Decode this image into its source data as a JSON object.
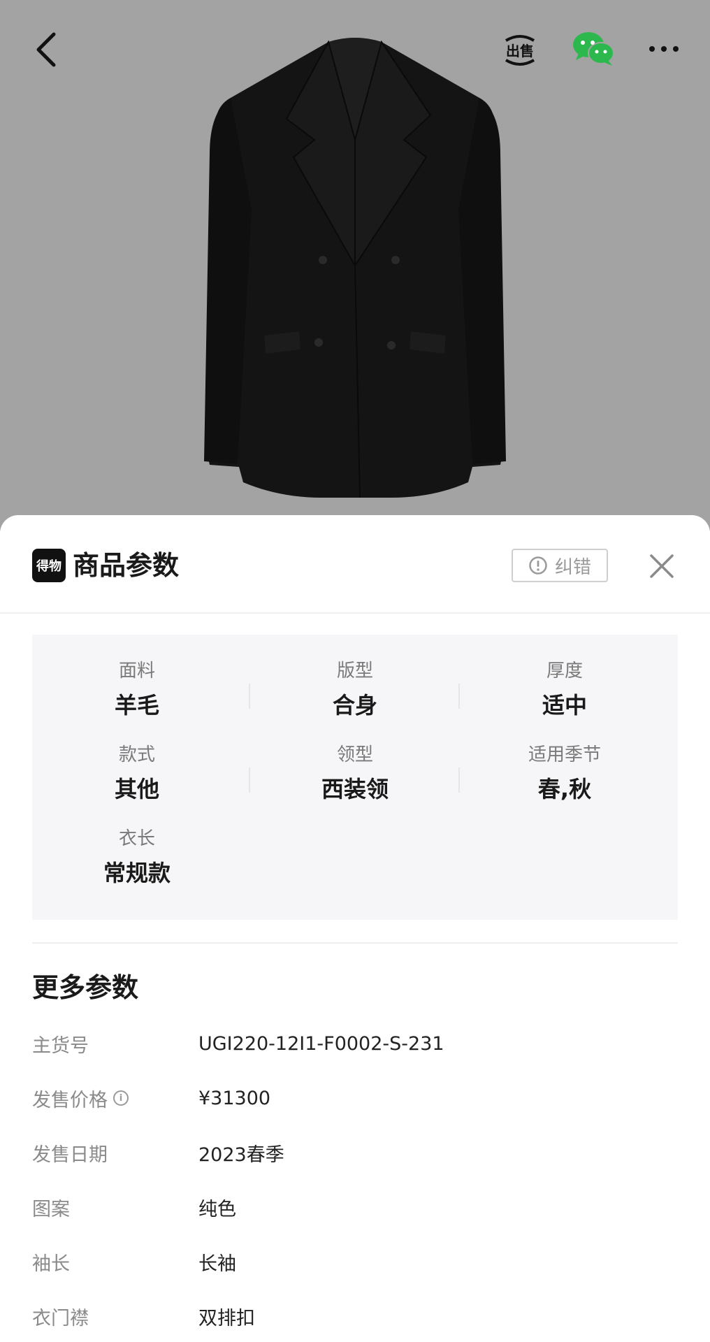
{
  "header": {
    "back_icon": "chevron-left-icon",
    "sell_label": "出售",
    "wechat_icon": "wechat-icon",
    "more_icon": "more-dots-icon"
  },
  "sheet": {
    "logo_text": "得物",
    "title": "商品参数",
    "correct_label": "纠错",
    "close_icon": "close-icon"
  },
  "key_params": [
    {
      "label": "面料",
      "value": "羊毛"
    },
    {
      "label": "版型",
      "value": "合身"
    },
    {
      "label": "厚度",
      "value": "适中"
    },
    {
      "label": "款式",
      "value": "其他"
    },
    {
      "label": "领型",
      "value": "西装领"
    },
    {
      "label": "适用季节",
      "value": "春,秋"
    },
    {
      "label": "衣长",
      "value": "常规款"
    }
  ],
  "more": {
    "title": "更多参数",
    "rows": [
      {
        "label": "主货号",
        "value": "UGI220-12I1-F0002-S-231"
      },
      {
        "label": "发售价格",
        "value": "¥31300"
      },
      {
        "label": "发售日期",
        "value": "2023春季"
      },
      {
        "label": "图案",
        "value": "纯色"
      },
      {
        "label": "袖长",
        "value": "长袖"
      },
      {
        "label": "衣门襟",
        "value": "双排扣"
      }
    ]
  },
  "colors": {
    "hero_bg": "#a3a3a3",
    "sheet_bg": "#ffffff",
    "params_bg": "#f6f6f8",
    "wechat_green": "#2db84d"
  }
}
